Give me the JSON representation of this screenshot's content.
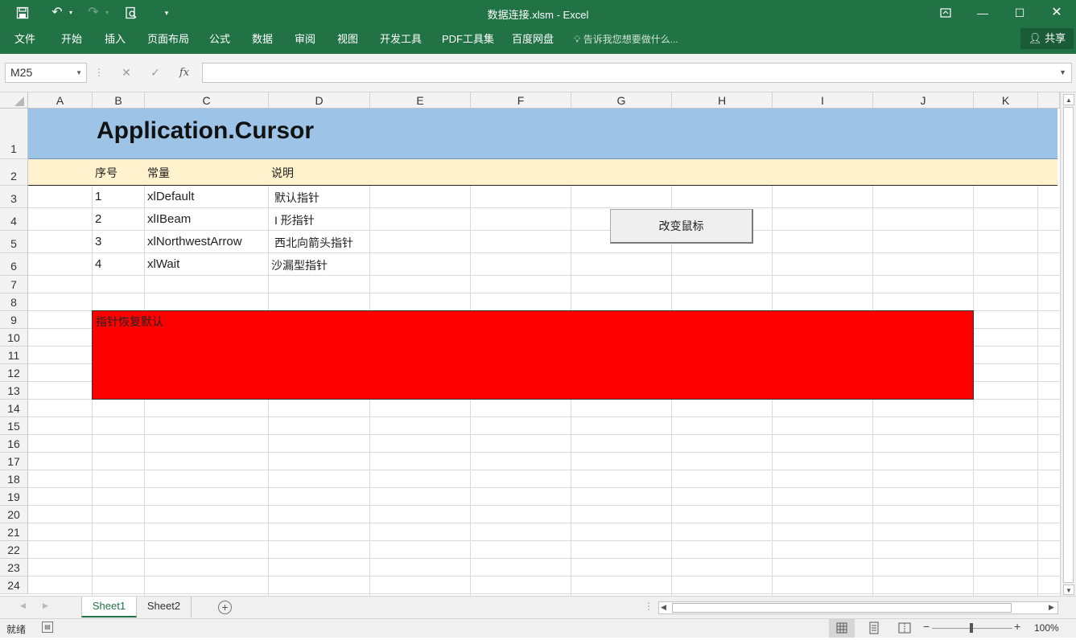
{
  "window": {
    "title": "数据连接.xlsm - Excel"
  },
  "ribbon": {
    "tabs": [
      "文件",
      "开始",
      "插入",
      "页面布局",
      "公式",
      "数据",
      "审阅",
      "视图",
      "开发工具",
      "PDF工具集",
      "百度网盘"
    ],
    "tell_me": "告诉我您想要做什么...",
    "share": "共享"
  },
  "formula_bar": {
    "name_box": "M25",
    "formula": ""
  },
  "columns": [
    "A",
    "B",
    "C",
    "D",
    "E",
    "F",
    "G",
    "H",
    "I",
    "J",
    "K"
  ],
  "rows": [
    "1",
    "2",
    "3",
    "4",
    "5",
    "6",
    "7",
    "8",
    "9",
    "10",
    "11",
    "12",
    "13",
    "14",
    "15",
    "16",
    "17",
    "18",
    "19",
    "20",
    "21",
    "22",
    "23",
    "24"
  ],
  "sheet": {
    "title": "Application.Cursor",
    "headers": {
      "index": "序号",
      "constant": "常量",
      "description": "说明"
    },
    "items": [
      {
        "index": "1",
        "constant": "xlDefault",
        "description": "默认指针"
      },
      {
        "index": "2",
        "constant": "xlIBeam",
        "description": "I 形指针"
      },
      {
        "index": "3",
        "constant": "xlNorthwestArrow",
        "description": "西北向箭头指针"
      },
      {
        "index": "4",
        "constant": "xlWait",
        "description": "沙漏型指针"
      }
    ],
    "change_cursor_button": "改变鼠标",
    "reset_shape_text": "指针恢复默认"
  },
  "sheet_tabs": [
    "Sheet1",
    "Sheet2"
  ],
  "active_sheet": "Sheet1",
  "status": {
    "ready": "就绪",
    "zoom": "100%"
  },
  "colors": {
    "excel_green": "#217346",
    "title_fill": "#9dc3e6",
    "header_fill": "#fff2cc",
    "shape_fill": "#ff0000"
  }
}
